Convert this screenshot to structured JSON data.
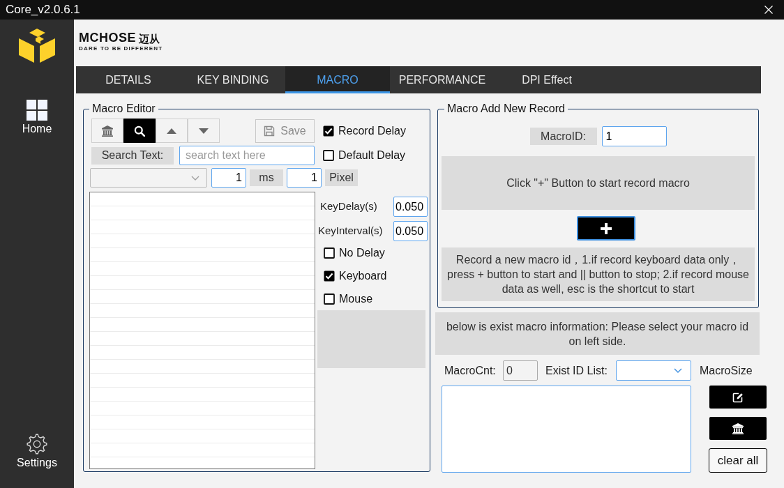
{
  "window": {
    "title": "Core_v2.0.6.1"
  },
  "sidebar": {
    "items": [
      {
        "kind": "home",
        "label": "Home"
      },
      {
        "kind": "settings",
        "label": "Settings"
      }
    ]
  },
  "brand": {
    "name": "MCHOSE",
    "name_cn": "迈从",
    "tagline": "DARE TO BE DIFFERENT"
  },
  "tabs": [
    {
      "label": "DETAILS",
      "selected": false
    },
    {
      "label": "KEY BINDING",
      "selected": false
    },
    {
      "label": "MACRO",
      "selected": true
    },
    {
      "label": "PERFORMANCE",
      "selected": false
    },
    {
      "label": "DPI Effect",
      "selected": false
    }
  ],
  "macro_editor": {
    "title": "Macro Editor",
    "tools": [
      {
        "kind": "bank",
        "selected": false
      },
      {
        "kind": "search",
        "selected": true
      },
      {
        "kind": "up",
        "selected": false
      },
      {
        "kind": "down",
        "selected": false
      }
    ],
    "save_button": "Save",
    "search": {
      "label": "Search Text:",
      "placeholder": "search text here"
    },
    "record_options": [
      {
        "label": "Record Delay",
        "checked": true
      },
      {
        "label": "Default Delay",
        "checked": false
      }
    ],
    "delay": {
      "value": "1",
      "unit": "ms"
    },
    "offset": {
      "value": "1",
      "unit": "Pixel"
    },
    "key_delay": {
      "label": "KeyDelay(s)",
      "value": "0.050"
    },
    "key_interval": {
      "label": "KeyInterval(s)",
      "value": "0.050"
    },
    "filters": [
      {
        "label": "No Delay",
        "checked": false
      },
      {
        "label": "Keyboard",
        "checked": true
      },
      {
        "label": "Mouse",
        "checked": false
      }
    ]
  },
  "add_record": {
    "title": "Macro Add New Record",
    "macro_id": {
      "label": "MacroID:",
      "value": "1"
    },
    "hint": "Click \"+\" Button to start record macro",
    "instructions": "Record a new macro id，1.if record keyboard data only，press + button to start and || button to stop; 2.if record mouse data as well, esc is the shortcut to start"
  },
  "existing": {
    "info": "below is exist macro information: Please select your macro id on left side.",
    "count": {
      "label": "MacroCnt:",
      "value": "0"
    },
    "id_list": {
      "label": "Exist ID List:"
    },
    "size_label": "MacroSize",
    "icon_buttons": [
      {
        "kind": "edit"
      },
      {
        "kind": "bank"
      }
    ],
    "clear_button": "clear all"
  }
}
